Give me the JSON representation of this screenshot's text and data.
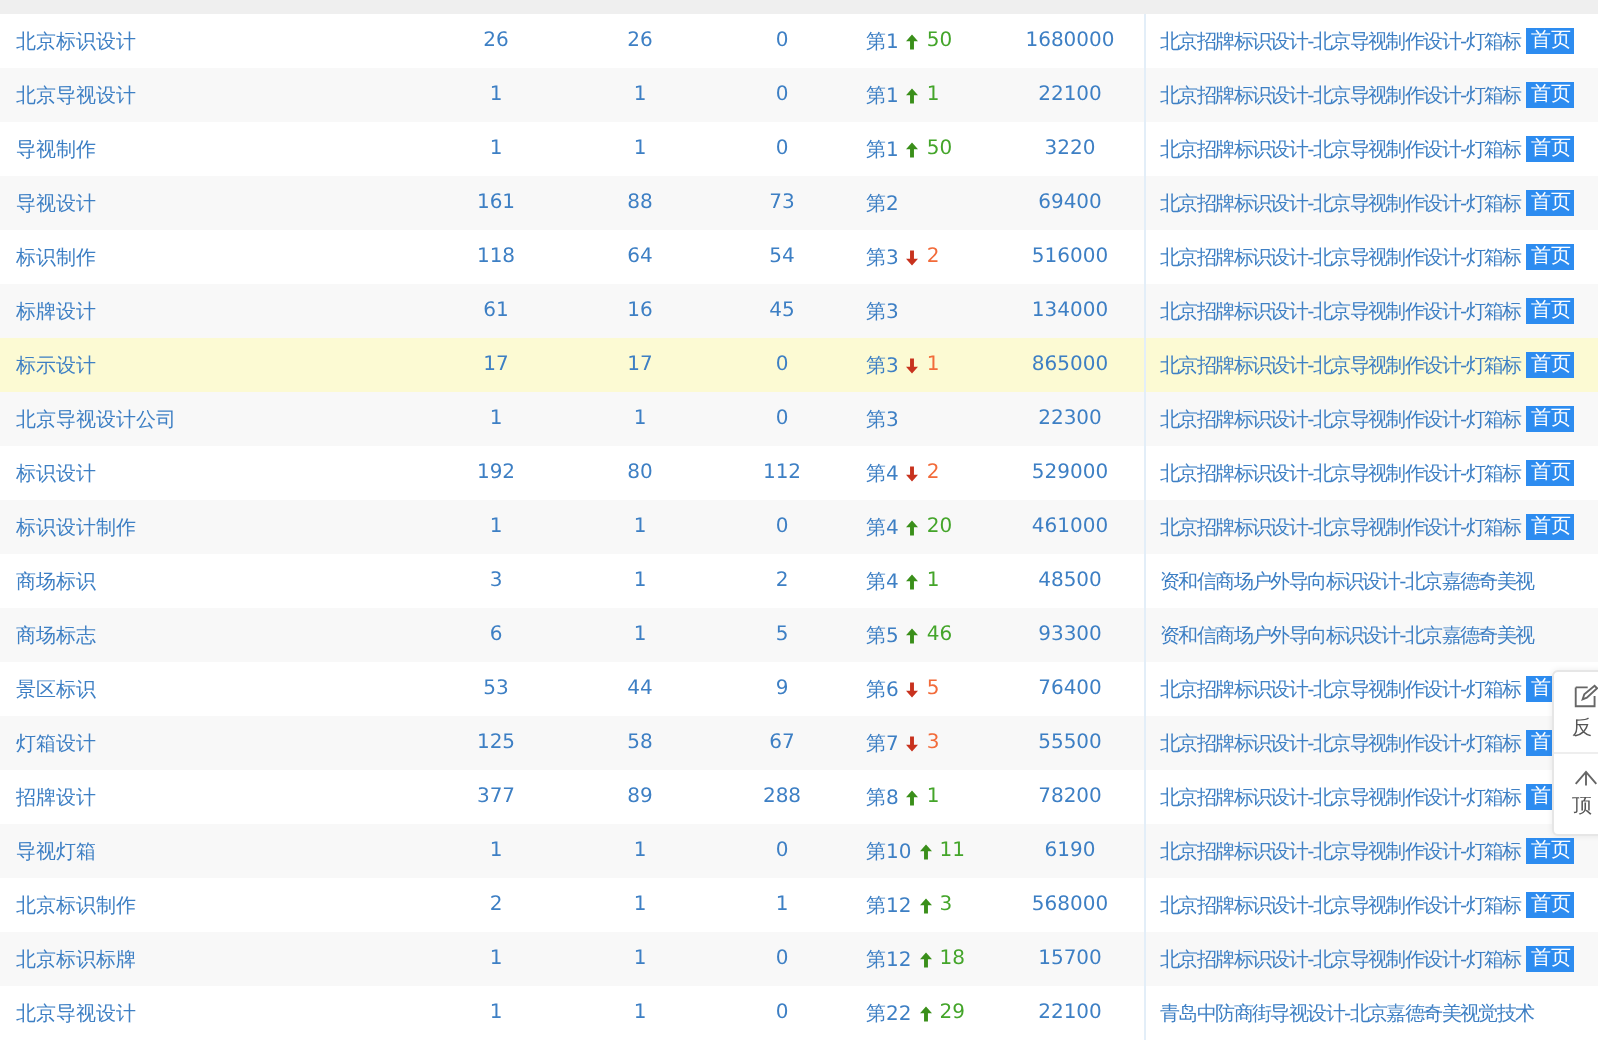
{
  "rows": [
    {
      "keyword": "北京标识设计",
      "col_2": "26",
      "col_3": "26",
      "col_4": "0",
      "rank": "第1",
      "change": {
        "up": true,
        "value": "50"
      },
      "col_6": "1680000",
      "title": "北京招牌标识设计-北京导视制作设计-灯箱标",
      "badge": "首页",
      "highlighted": false
    },
    {
      "keyword": "北京导视设计",
      "col_2": "1",
      "col_3": "1",
      "col_4": "0",
      "rank": "第1",
      "change": {
        "up": true,
        "value": "1"
      },
      "col_6": "22100",
      "title": "北京招牌标识设计-北京导视制作设计-灯箱标",
      "badge": "首页",
      "highlighted": false
    },
    {
      "keyword": "导视制作",
      "col_2": "1",
      "col_3": "1",
      "col_4": "0",
      "rank": "第1",
      "change": {
        "up": true,
        "value": "50"
      },
      "col_6": "3220",
      "title": "北京招牌标识设计-北京导视制作设计-灯箱标",
      "badge": "首页",
      "highlighted": false
    },
    {
      "keyword": "导视设计",
      "col_2": "161",
      "col_3": "88",
      "col_4": "73",
      "rank": "第2",
      "col_6": "69400",
      "title": "北京招牌标识设计-北京导视制作设计-灯箱标",
      "badge": "首页",
      "highlighted": false
    },
    {
      "keyword": "标识制作",
      "col_2": "118",
      "col_3": "64",
      "col_4": "54",
      "rank": "第3",
      "change": {
        "up": false,
        "value": "2"
      },
      "col_6": "516000",
      "title": "北京招牌标识设计-北京导视制作设计-灯箱标",
      "badge": "首页",
      "highlighted": false
    },
    {
      "keyword": "标牌设计",
      "col_2": "61",
      "col_3": "16",
      "col_4": "45",
      "rank": "第3",
      "col_6": "134000",
      "title": "北京招牌标识设计-北京导视制作设计-灯箱标",
      "badge": "首页",
      "highlighted": false
    },
    {
      "keyword": "标示设计",
      "col_2": "17",
      "col_3": "17",
      "col_4": "0",
      "rank": "第3",
      "change": {
        "up": false,
        "value": "1"
      },
      "col_6": "865000",
      "title": "北京招牌标识设计-北京导视制作设计-灯箱标",
      "badge": "首页",
      "highlighted": true
    },
    {
      "keyword": "北京导视设计公司",
      "col_2": "1",
      "col_3": "1",
      "col_4": "0",
      "rank": "第3",
      "col_6": "22300",
      "title": "北京招牌标识设计-北京导视制作设计-灯箱标",
      "badge": "首页",
      "highlighted": false
    },
    {
      "keyword": "标识设计",
      "col_2": "192",
      "col_3": "80",
      "col_4": "112",
      "rank": "第4",
      "change": {
        "up": false,
        "value": "2"
      },
      "col_6": "529000",
      "title": "北京招牌标识设计-北京导视制作设计-灯箱标",
      "badge": "首页",
      "highlighted": false
    },
    {
      "keyword": "标识设计制作",
      "col_2": "1",
      "col_3": "1",
      "col_4": "0",
      "rank": "第4",
      "change": {
        "up": true,
        "value": "20"
      },
      "col_6": "461000",
      "title": "北京招牌标识设计-北京导视制作设计-灯箱标",
      "badge": "首页",
      "highlighted": false
    },
    {
      "keyword": "商场标识",
      "col_2": "3",
      "col_3": "1",
      "col_4": "2",
      "rank": "第4",
      "change": {
        "up": true,
        "value": "1"
      },
      "col_6": "48500",
      "title": "资和信商场户外导向标识设计-北京嘉德奇美视",
      "highlighted": false
    },
    {
      "keyword": "商场标志",
      "col_2": "6",
      "col_3": "1",
      "col_4": "5",
      "rank": "第5",
      "change": {
        "up": true,
        "value": "46"
      },
      "col_6": "93300",
      "title": "资和信商场户外导向标识设计-北京嘉德奇美视",
      "highlighted": false
    },
    {
      "keyword": "景区标识",
      "col_2": "53",
      "col_3": "44",
      "col_4": "9",
      "rank": "第6",
      "change": {
        "up": false,
        "value": "5"
      },
      "col_6": "76400",
      "title": "北京招牌标识设计-北京导视制作设计-灯箱标",
      "badge": "首",
      "highlighted": false
    },
    {
      "keyword": "灯箱设计",
      "col_2": "125",
      "col_3": "58",
      "col_4": "67",
      "rank": "第7",
      "change": {
        "up": false,
        "value": "3"
      },
      "col_6": "55500",
      "title": "北京招牌标识设计-北京导视制作设计-灯箱标",
      "badge": "首",
      "highlighted": false
    },
    {
      "keyword": "招牌设计",
      "col_2": "377",
      "col_3": "89",
      "col_4": "288",
      "rank": "第8",
      "change": {
        "up": true,
        "value": "1"
      },
      "col_6": "78200",
      "title": "北京招牌标识设计-北京导视制作设计-灯箱标",
      "badge": "首",
      "highlighted": false
    },
    {
      "keyword": "导视灯箱",
      "col_2": "1",
      "col_3": "1",
      "col_4": "0",
      "rank": "第10",
      "change": {
        "up": true,
        "value": "11"
      },
      "col_6": "6190",
      "title": "北京招牌标识设计-北京导视制作设计-灯箱标",
      "badge": "首页",
      "highlighted": false
    },
    {
      "keyword": "北京标识制作",
      "col_2": "2",
      "col_3": "1",
      "col_4": "1",
      "rank": "第12",
      "change": {
        "up": true,
        "value": "3"
      },
      "col_6": "568000",
      "title": "北京招牌标识设计-北京导视制作设计-灯箱标",
      "badge": "首页",
      "highlighted": false
    },
    {
      "keyword": "北京标识标牌",
      "col_2": "1",
      "col_3": "1",
      "col_4": "0",
      "rank": "第12",
      "change": {
        "up": true,
        "value": "18"
      },
      "col_6": "15700",
      "title": "北京招牌标识设计-北京导视制作设计-灯箱标",
      "badge": "首页",
      "highlighted": false
    },
    {
      "keyword": "北京导视设计",
      "col_2": "1",
      "col_3": "1",
      "col_4": "0",
      "rank": "第22",
      "change": {
        "up": true,
        "value": "29"
      },
      "col_6": "22100",
      "title": "青岛中防商街导视设计-北京嘉德奇美视觉技术",
      "highlighted": false
    }
  ],
  "side_widget": {
    "feedback": "反",
    "top": "顶"
  }
}
